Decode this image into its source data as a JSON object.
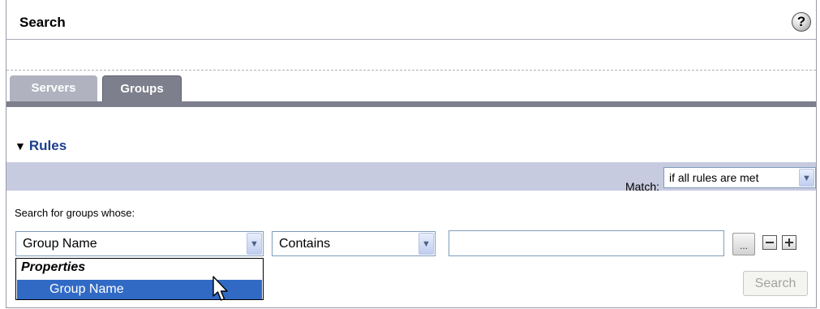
{
  "header": {
    "title": "Search",
    "help_glyph": "?"
  },
  "tabs": [
    {
      "label": "Servers",
      "active": false
    },
    {
      "label": "Groups",
      "active": true
    }
  ],
  "rules": {
    "heading": "Rules",
    "match_label": "Match:",
    "match_value": "if all rules are met",
    "subheading": "Search for groups whose:",
    "field_select_value": "Group Name",
    "operator_select_value": "Contains",
    "value_input": "",
    "ellipsis_label": "...",
    "dropdown": {
      "group_label": "Properties",
      "highlighted_option": "Group Name"
    },
    "search_button": "Search"
  },
  "colors": {
    "tab_active": "#7d7f8c",
    "band": "#c7cbe0",
    "highlight": "#316ac5",
    "heading": "#1b3f8b"
  }
}
